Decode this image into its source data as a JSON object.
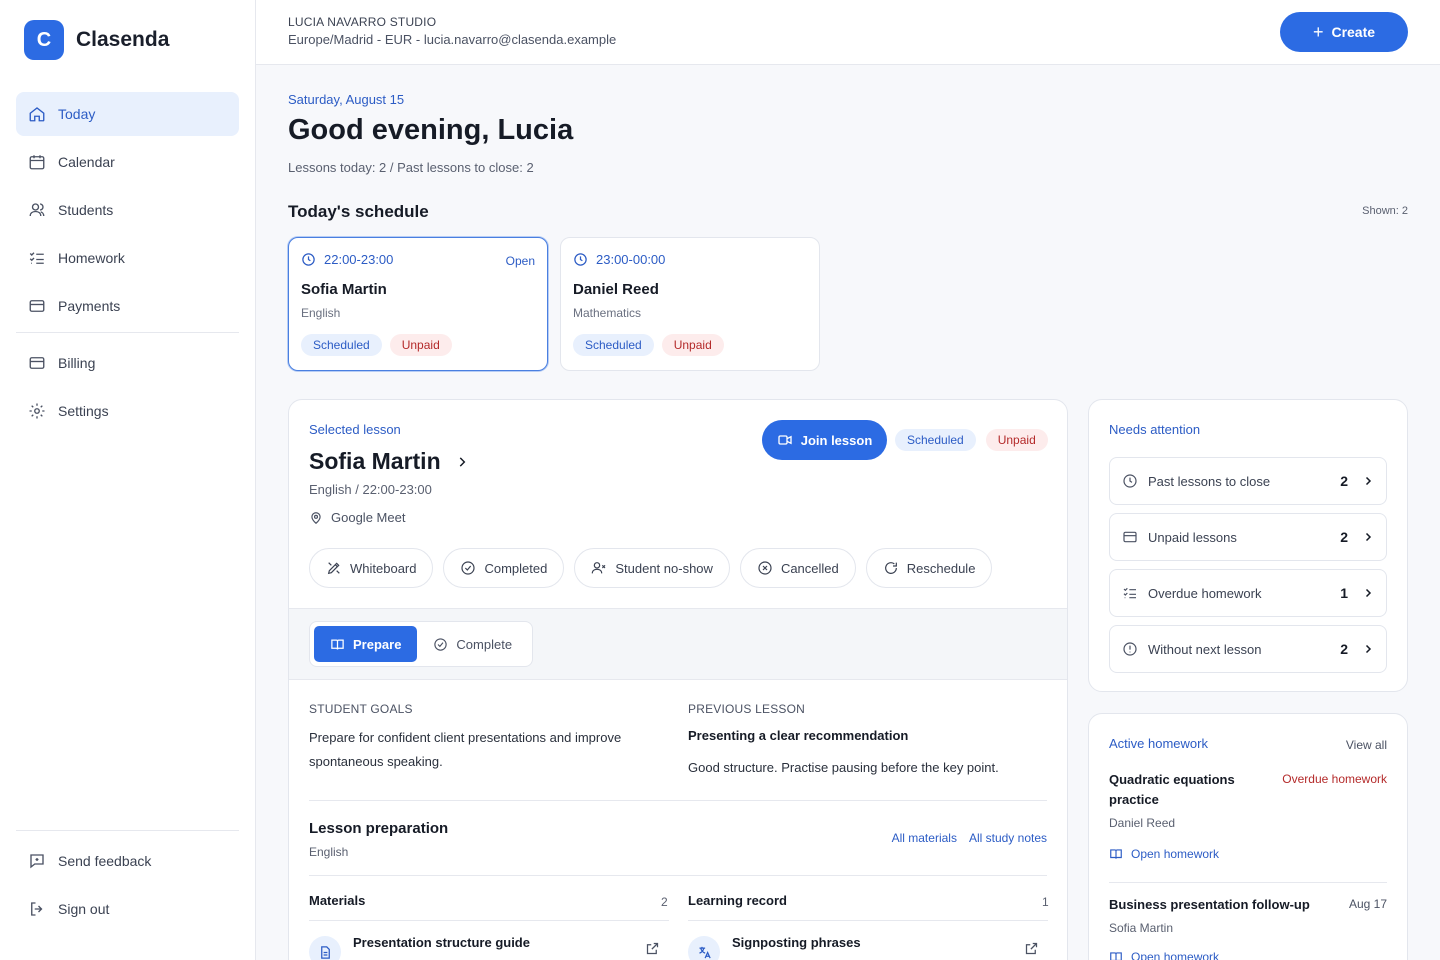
{
  "app": {
    "logo_letter": "C",
    "name": "Clasenda"
  },
  "nav": {
    "items": [
      {
        "label": "Today",
        "icon": "home-icon"
      },
      {
        "label": "Calendar",
        "icon": "calendar-icon"
      },
      {
        "label": "Students",
        "icon": "users-icon"
      },
      {
        "label": "Homework",
        "icon": "checklist-icon"
      },
      {
        "label": "Payments",
        "icon": "card-icon"
      }
    ],
    "secondary": [
      {
        "label": "Billing",
        "icon": "card-icon"
      },
      {
        "label": "Settings",
        "icon": "gear-icon"
      }
    ],
    "footer": [
      {
        "label": "Send feedback",
        "icon": "feedback-icon"
      },
      {
        "label": "Sign out",
        "icon": "sign-out-icon"
      }
    ]
  },
  "topbar": {
    "studio_name": "LUCIA NAVARRO STUDIO",
    "studio_meta": "Europe/Madrid - EUR - lucia.navarro@clasenda.example",
    "create_label": "Create"
  },
  "today": {
    "date": "Saturday, August 15",
    "greeting": "Good evening, Lucia",
    "summary": "Lessons today: 2 / Past lessons to close: 2",
    "schedule_title": "Today's schedule",
    "shown": "Shown: 2"
  },
  "schedule": [
    {
      "time": "22:00-23:00",
      "status": "Open",
      "student": "Sofia Martin",
      "subject": "English",
      "badge1": "Scheduled",
      "badge2": "Unpaid"
    },
    {
      "time": "23:00-00:00",
      "status": "",
      "student": "Daniel Reed",
      "subject": "Mathematics",
      "badge1": "Scheduled",
      "badge2": "Unpaid"
    }
  ],
  "selected": {
    "label": "Selected lesson",
    "student": "Sofia Martin",
    "subtitle": "English / 22:00-23:00",
    "location": "Google Meet",
    "join_label": "Join lesson",
    "badge1": "Scheduled",
    "badge2": "Unpaid",
    "actions": [
      "Whiteboard",
      "Completed",
      "Student no-show",
      "Cancelled",
      "Reschedule"
    ],
    "tabs": [
      "Prepare",
      "Complete"
    ],
    "goals_head": "STUDENT GOALS",
    "goals_text": "Prepare for confident client presentations and improve spontaneous speaking.",
    "prev_head": "PREVIOUS LESSON",
    "prev_title": "Presenting a clear recommendation",
    "prev_note": "Good structure. Practise pausing before the key point.",
    "prep_title": "Lesson preparation",
    "prep_sub": "English",
    "link_materials": "All materials",
    "link_notes": "All study notes",
    "materials_head": "Materials",
    "materials_count": "2",
    "record_head": "Learning record",
    "record_count": "1",
    "material_item": "Presentation structure guide",
    "record_item": "Signposting phrases"
  },
  "attention": {
    "title": "Needs attention",
    "items": [
      {
        "label": "Past lessons to close",
        "count": "2"
      },
      {
        "label": "Unpaid lessons",
        "count": "2"
      },
      {
        "label": "Overdue homework",
        "count": "1"
      },
      {
        "label": "Without next lesson",
        "count": "2"
      }
    ]
  },
  "homework": {
    "title": "Active homework",
    "view_all": "View all",
    "items": [
      {
        "title": "Quadratic equations practice",
        "status": "Overdue homework",
        "student": "Daniel Reed",
        "open": "Open homework"
      },
      {
        "title": "Business presentation follow-up",
        "status": "Aug 17",
        "student": "Sofia Martin",
        "open": "Open homework"
      }
    ]
  },
  "colors": {
    "accent": "#2c6be3",
    "accent_text": "#2c5cc5",
    "danger": "#b42a2a"
  }
}
